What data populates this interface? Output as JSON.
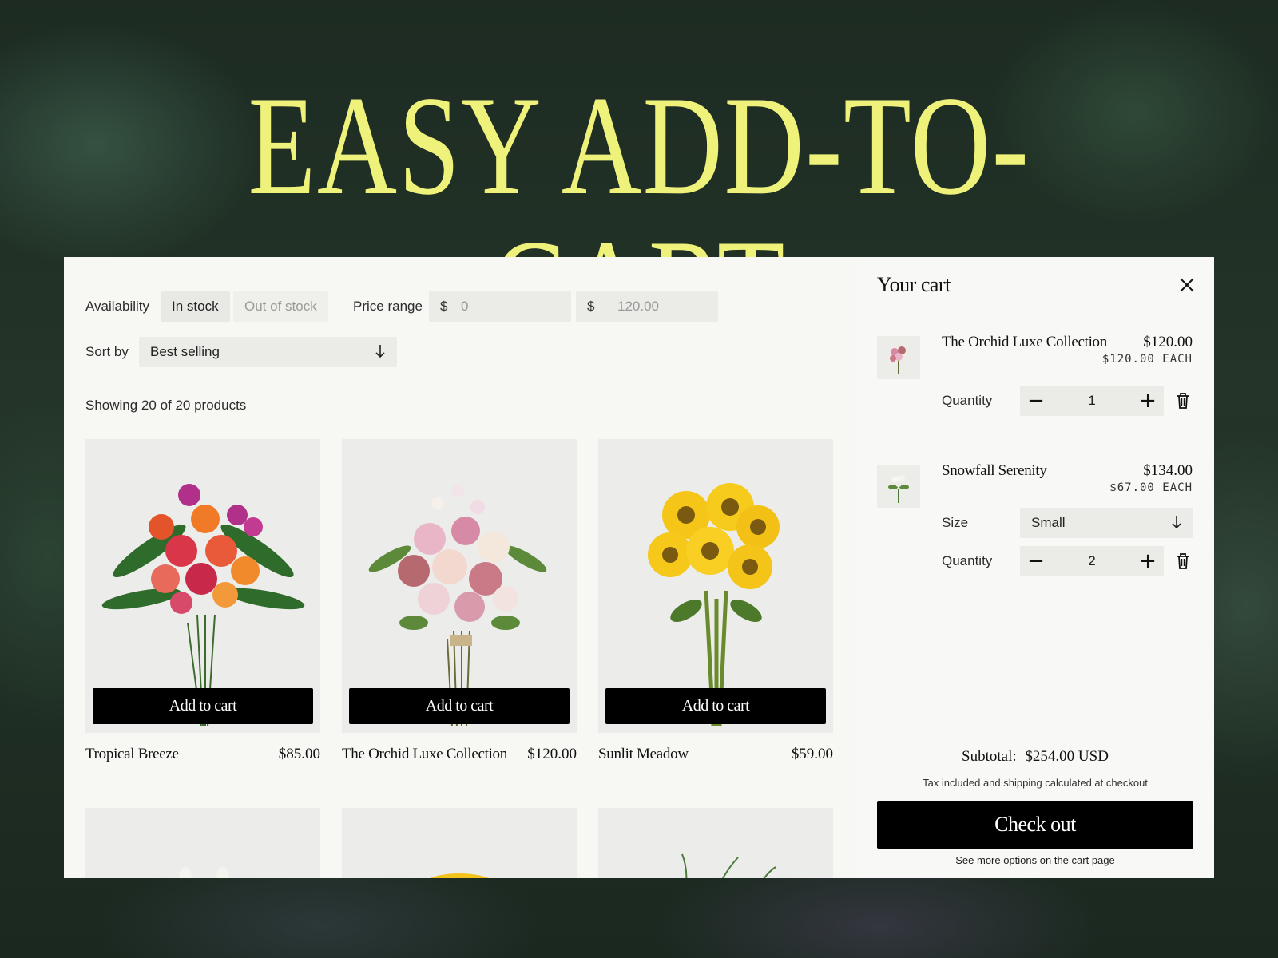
{
  "hero": {
    "title": "EASY ADD-TO-CART"
  },
  "filters": {
    "availability_label": "Availability",
    "in_stock": "In stock",
    "out_of_stock": "Out of stock",
    "price_range_label": "Price range",
    "currency": "$",
    "min_value": "0",
    "max_value": "120.00",
    "sort_label": "Sort by",
    "sort_value": "Best selling"
  },
  "results": {
    "count_text": "Showing 20 of 20 products"
  },
  "products": [
    {
      "name": "Tropical Breeze",
      "price": "$85.00",
      "button": "Add to cart"
    },
    {
      "name": "The Orchid Luxe Collection",
      "price": "$120.00",
      "button": "Add to cart"
    },
    {
      "name": "Sunlit Meadow",
      "price": "$59.00",
      "button": "Add to cart"
    }
  ],
  "cart": {
    "title": "Your cart",
    "items": [
      {
        "name": "The Orchid Luxe Collection",
        "total": "$120.00",
        "each": "$120.00 EACH",
        "quantity_label": "Quantity",
        "quantity": "1"
      },
      {
        "name": "Snowfall Serenity",
        "total": "$134.00",
        "each": "$67.00 EACH",
        "size_label": "Size",
        "size": "Small",
        "quantity_label": "Quantity",
        "quantity": "2"
      }
    ],
    "subtotal_label": "Subtotal:",
    "subtotal_value": "$254.00 USD",
    "tax_note": "Tax included and shipping calculated at checkout",
    "checkout": "Check out",
    "more_options_prefix": "See more options on the",
    "cart_page_link": "cart page"
  },
  "colors": {
    "hero_text": "#eef27a",
    "button_bg": "#000000",
    "panel_bg": "#f7f7f4"
  }
}
